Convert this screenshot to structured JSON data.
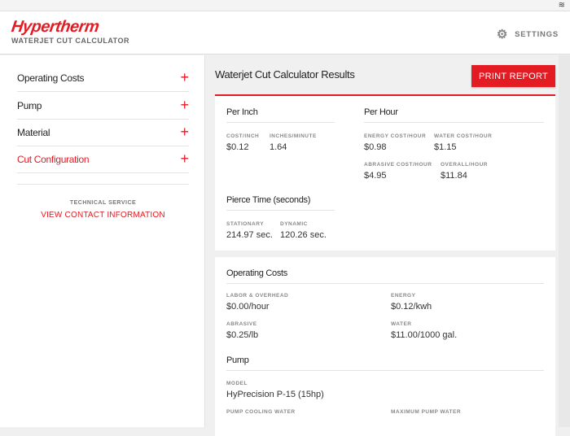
{
  "header": {
    "logo": "Hypertherm",
    "subtitle": "WATERJET CUT CALCULATOR",
    "settings": "SETTINGS"
  },
  "sidebar": {
    "items": [
      {
        "label": "Operating Costs"
      },
      {
        "label": "Pump"
      },
      {
        "label": "Material"
      },
      {
        "label": "Cut Configuration"
      }
    ],
    "plus": "+",
    "tech_title": "TECHNICAL SERVICE",
    "tech_link": "VIEW CONTACT INFORMATION"
  },
  "main": {
    "title": "Waterjet Cut Calculator Results",
    "print": "PRINT REPORT",
    "per_inch": {
      "title": "Per Inch",
      "cost_k": "COST/INCH",
      "cost_v": "$0.12",
      "ipm_k": "INCHES/MINUTE",
      "ipm_v": "1.64"
    },
    "per_hour": {
      "title": "Per Hour",
      "energy_k": "ENERGY COST/HOUR",
      "energy_v": "$0.98",
      "water_k": "WATER COST/HOUR",
      "water_v": "$1.15",
      "abrasive_k": "ABRASIVE COST/HOUR",
      "abrasive_v": "$4.95",
      "overall_k": "OVERALL/HOUR",
      "overall_v": "$11.84"
    },
    "pierce": {
      "title": "Pierce Time (seconds)",
      "stat_k": "STATIONARY",
      "stat_v": "214.97 sec.",
      "dyn_k": "DYNAMIC",
      "dyn_v": "120.26 sec."
    },
    "opcosts": {
      "title": "Operating Costs",
      "labor_k": "LABOR & OVERHEAD",
      "labor_v": "$0.00/hour",
      "energy_k": "ENERGY",
      "energy_v": "$0.12/kwh",
      "abrasive_k": "ABRASIVE",
      "abrasive_v": "$0.25/lb",
      "water_k": "WATER",
      "water_v": "$11.00/1000 gal."
    },
    "pump": {
      "title": "Pump",
      "model_k": "MODEL",
      "model_v": "HyPrecision P-15 (15hp)",
      "cool_k": "PUMP COOLING WATER",
      "max_k": "MAXIMUM PUMP WATER"
    }
  }
}
